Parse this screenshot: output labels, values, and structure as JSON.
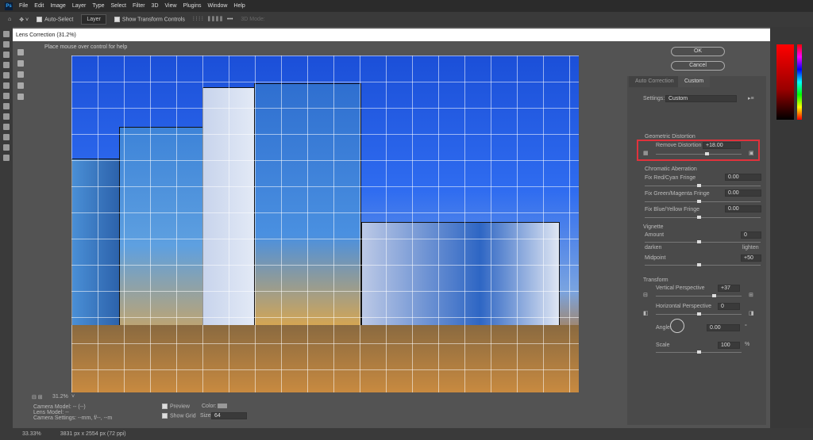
{
  "menu": [
    "File",
    "Edit",
    "Image",
    "Layer",
    "Type",
    "Select",
    "Filter",
    "3D",
    "View",
    "Plugins",
    "Window",
    "Help"
  ],
  "options": {
    "auto_select": "Auto-Select",
    "layer": "Layer",
    "show_transform": "Show Transform Controls",
    "mode_3d": "3D Mode:"
  },
  "dialog": {
    "title": "Lens Correction (31.2%)",
    "help": "Place mouse over control for help",
    "ok": "OK",
    "cancel": "Cancel",
    "tabs": [
      "Auto Correction",
      "Custom"
    ],
    "settings_label": "Settings:",
    "settings_value": "Custom",
    "geometric": {
      "title": "Geometric Distortion",
      "label": "Remove Distortion",
      "value": "+18.00",
      "fraction": 0.59
    },
    "chromatic": {
      "title": "Chromatic Aberration",
      "items": [
        {
          "label": "Fix Red/Cyan Fringe",
          "value": "0.00"
        },
        {
          "label": "Fix Green/Magenta Fringe",
          "value": "0.00"
        },
        {
          "label": "Fix Blue/Yellow Fringe",
          "value": "0.00"
        }
      ]
    },
    "vignette": {
      "title": "Vignette",
      "amount_label": "Amount",
      "amount": "0",
      "darken": "darken",
      "lighten": "lighten",
      "midpoint_label": "Midpoint",
      "midpoint": "+50"
    },
    "transform": {
      "title": "Transform",
      "vp_label": "Vertical Perspective",
      "vp": "+37",
      "hp_label": "Horizontal Perspective",
      "hp": "0",
      "angle_label": "Angle:",
      "angle": "0.00",
      "angle_unit": "°",
      "scale_label": "Scale",
      "scale": "100",
      "scale_unit": "%"
    },
    "zoom": "31.2%",
    "camera_model": "Camera Model: -- (--)",
    "lens_model": "Lens Model: --",
    "camera_settings": "Camera Settings: --mm, f/--, --m",
    "preview": "Preview",
    "show_grid": "Show Grid",
    "color_label": "Color:",
    "size_label": "Size:",
    "size_value": "64"
  },
  "status": {
    "zoom": "33.33%",
    "doc": "3831 px x 2554 px (72 ppi)"
  }
}
